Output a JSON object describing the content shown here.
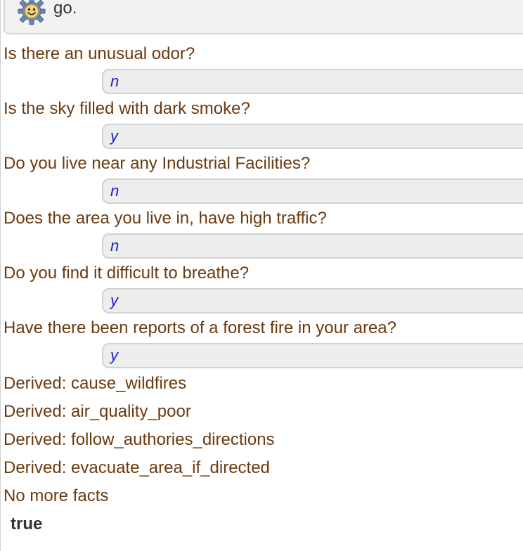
{
  "query": {
    "icon": "gear-smiley-icon",
    "text": "go."
  },
  "dialog": [
    {
      "question": "Is there an unusual odor?",
      "answer": "n"
    },
    {
      "question": "Is the sky filled with dark smoke?",
      "answer": "y"
    },
    {
      "question": "Do you live near any Industrial Facilities?",
      "answer": "n"
    },
    {
      "question": "Does the area you live in, have high traffic?",
      "answer": "n"
    },
    {
      "question": "Do you find it difficult to breathe?",
      "answer": "y"
    },
    {
      "question": "Have there been reports of a forest fire in your area?",
      "answer": "y"
    }
  ],
  "derived": [
    "Derived: cause_wildfires",
    "Derived: air_quality_poor",
    "Derived: follow_authories_directions",
    "Derived: evacuate_area_if_directed"
  ],
  "final_message": "No more facts",
  "result": "true",
  "colors": {
    "prompt_text": "#6b3a0e",
    "answer_text": "#1a1ad6",
    "answer_bg": "#ededed",
    "result_text": "#333333"
  }
}
